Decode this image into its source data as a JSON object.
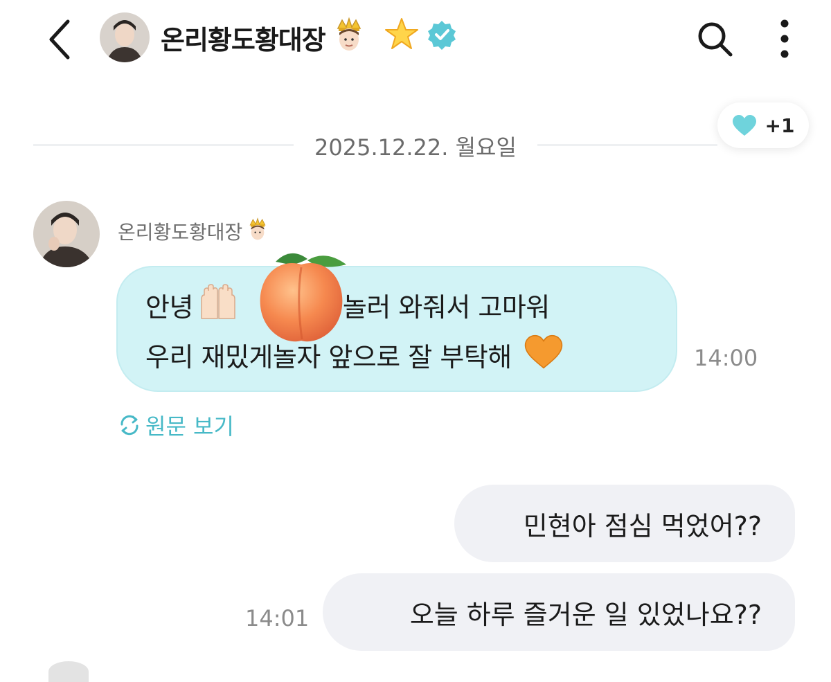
{
  "header": {
    "title": "온리황도황대장",
    "back_icon": "chevron-left-icon",
    "search_icon": "search-icon",
    "more_icon": "more-vertical-icon",
    "badges": [
      "prince-emoji",
      "star-emoji",
      "verified-badge-icon"
    ]
  },
  "reaction": {
    "icon": "heart-icon",
    "count": "+1"
  },
  "date_divider": "2025.12.22. 월요일",
  "incoming": {
    "sender_name": "온리황도황대장",
    "line1_start": "안녕",
    "line1_end": "놀러 와줘서 고마워",
    "line2_start": "우리 재밌게 ",
    "line2_end": "놀자 앞으로 잘 부탁해",
    "time": "14:00",
    "translate_label": "원문 보기"
  },
  "outgoing": [
    {
      "text": "민현아 점심 먹었어??"
    },
    {
      "text": "오늘 하루 즐거운 일 있었나요??"
    }
  ],
  "outgoing_time": "14:01",
  "colors": {
    "incoming_bubble": "#d2f3f6",
    "outgoing_bubble": "#f0f1f5",
    "accent": "#47b9c7",
    "verified": "#5bc8d6",
    "heart": "#6fd3dc"
  }
}
